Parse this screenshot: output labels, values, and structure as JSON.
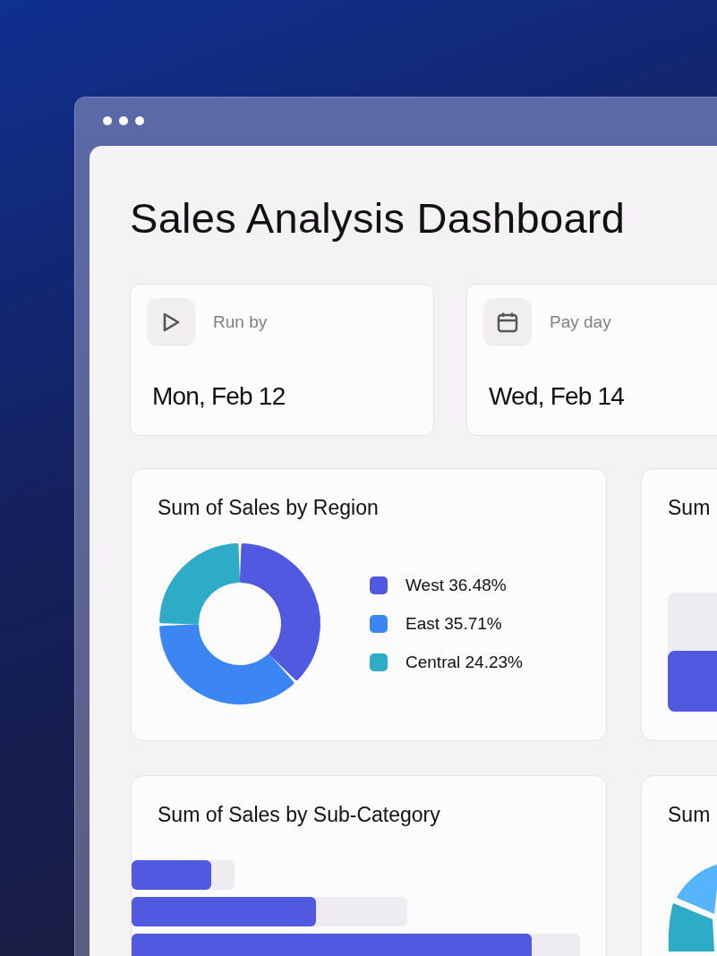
{
  "dashboard": {
    "title": "Sales Analysis Dashboard"
  },
  "info_cards": [
    {
      "kind": "play",
      "label": "Run by",
      "value": "Mon, Feb 12"
    },
    {
      "kind": "calendar",
      "label": "Pay day",
      "value": "Wed, Feb 14"
    }
  ],
  "chart_cards": [
    {
      "kind": "donut",
      "title": "Sum of Sales by Region",
      "chart_data": {
        "type": "donut",
        "categories": [
          "West",
          "East",
          "Central"
        ],
        "values": [
          36.48,
          35.71,
          24.23
        ],
        "value_labels": [
          "36.48%",
          "35.71%",
          "24.23%"
        ],
        "legend": [
          {
            "color": "#5059e0"
          },
          {
            "color": "#3b86f2"
          },
          {
            "color": "#2dabc7"
          }
        ]
      }
    },
    {
      "kind": "column_picture",
      "title": "Sum"
    },
    {
      "kind": "bar_picture",
      "title": "Sum of Sales by Sub-Category"
    },
    {
      "kind": "donut_picture",
      "title": "Sum"
    }
  ]
}
